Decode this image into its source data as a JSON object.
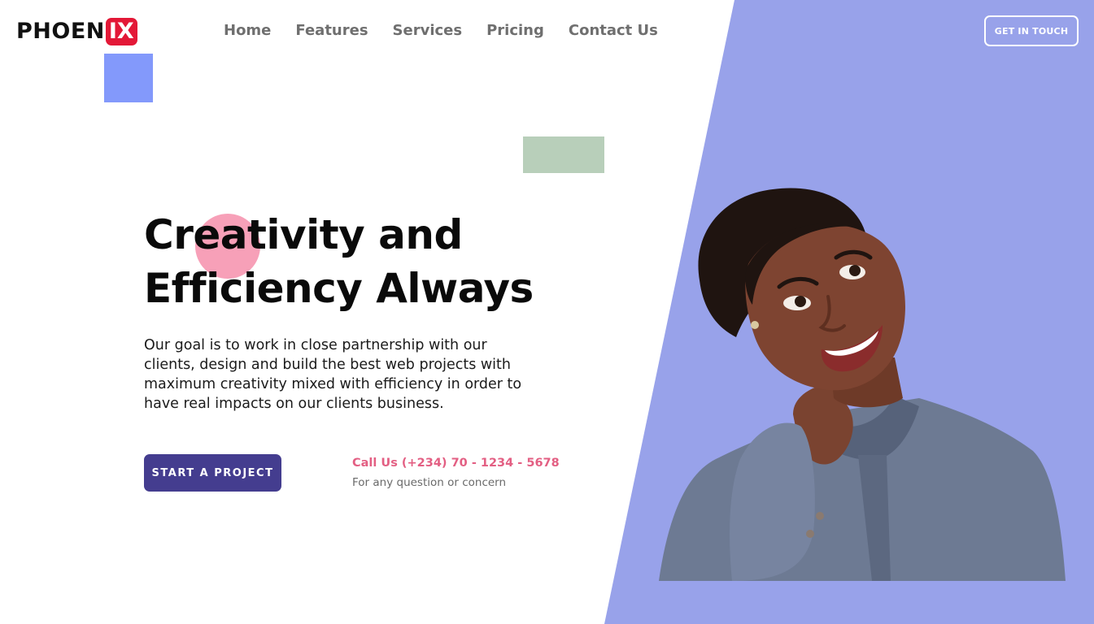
{
  "colors": {
    "accent_panel": "#98a2ea",
    "logo_badge": "#e31837",
    "primary_button": "#443d8f",
    "phone_text": "#e35f83",
    "decor_blue": "#8399fb",
    "decor_green": "#b8cfba",
    "decor_pink": "#f7a0b8"
  },
  "brand": {
    "logo_main": "PHOEN",
    "logo_accent": "IX"
  },
  "nav": {
    "items": [
      {
        "label": "Home"
      },
      {
        "label": "Features"
      },
      {
        "label": "Services"
      },
      {
        "label": "Pricing"
      },
      {
        "label": "Contact Us"
      }
    ],
    "cta": "GET IN TOUCH"
  },
  "hero": {
    "title_line1": "Creativity and",
    "title_line2": "Efficiency Always",
    "description": "Our goal is to work in close partnership with our clients, design and build the best web projects with maximum creativity mixed with efficiency in order to have real impacts on our clients business.",
    "primary_button": "START A PROJECT",
    "call_title": "Call Us (+234) 70 - 1234 - 5678",
    "call_subtitle": "For any question or concern"
  },
  "illustration": {
    "icon": "smiling-woman-portrait"
  }
}
